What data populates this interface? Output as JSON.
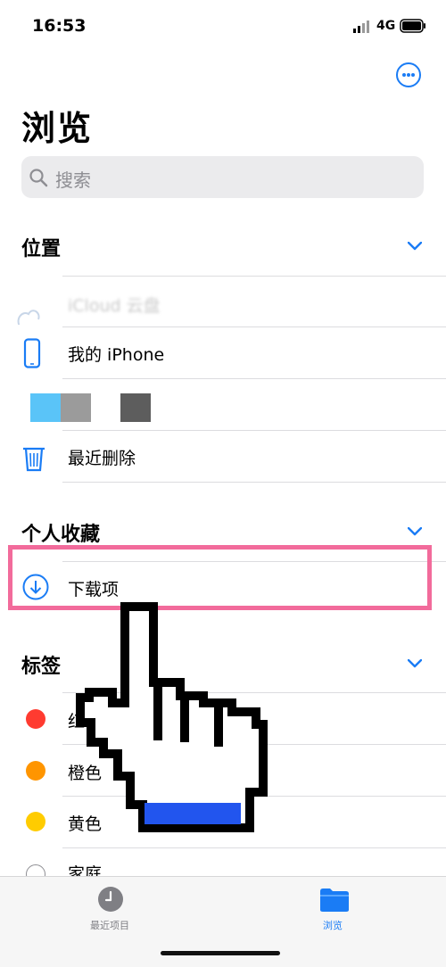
{
  "status_bar": {
    "time": "16:53",
    "network": "4G"
  },
  "header": {
    "title": "浏览"
  },
  "search": {
    "placeholder": "搜索"
  },
  "sections": {
    "locations": {
      "title": "位置",
      "items": [
        {
          "label": "iCloud 云盘"
        },
        {
          "label": "我的 iPhone"
        },
        {
          "label": "最近删除"
        }
      ]
    },
    "favorites": {
      "title": "个人收藏",
      "items": [
        {
          "label": "下载项"
        }
      ]
    },
    "tags": {
      "title": "标签",
      "items": [
        {
          "label": "红色",
          "color": "#ff3b30"
        },
        {
          "label": "橙色",
          "color": "#ff9500"
        },
        {
          "label": "黄色",
          "color": "#ffcc00"
        },
        {
          "label": "家庭",
          "color": "#ffffff"
        }
      ]
    }
  },
  "tabbar": {
    "tabs": [
      {
        "label": "最近项目",
        "icon": "clock-icon",
        "active": false
      },
      {
        "label": "浏览",
        "icon": "folder-icon",
        "active": true
      }
    ]
  },
  "colors": {
    "accent": "#1a7cf5",
    "highlight": "#f26b9b",
    "cursor_fill": "#2255ee"
  }
}
